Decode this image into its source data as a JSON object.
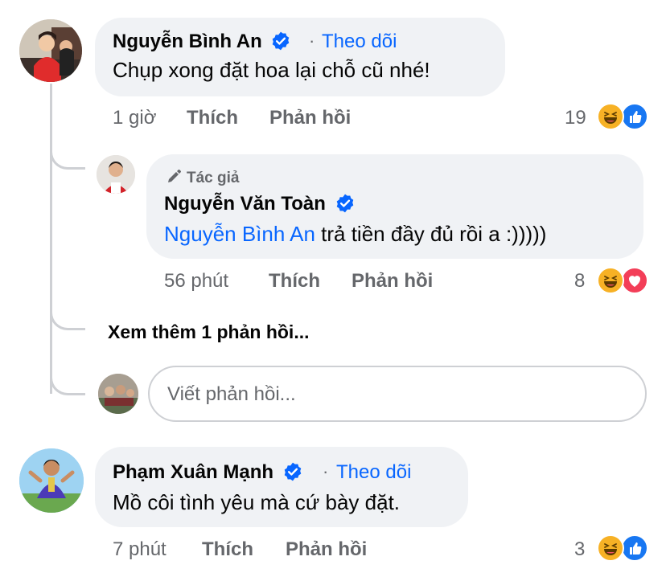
{
  "comment1": {
    "author": "Nguyễn Bình An",
    "follow_label": "Theo dõi",
    "text": "Chụp xong đặt hoa lại chỗ cũ nhé!",
    "time": "1 giờ",
    "like_label": "Thích",
    "reply_label": "Phản hồi",
    "reaction_count": "19",
    "reactions": [
      "haha-icon",
      "like-icon"
    ]
  },
  "reply1": {
    "author_badge": "Tác giả",
    "author": "Nguyễn Văn Toàn",
    "mention": "Nguyễn Bình An",
    "text": " trả tiền đầy đủ rồi a  :)))))",
    "time": "56 phút",
    "like_label": "Thích",
    "reply_label": "Phản hồi",
    "reaction_count": "8",
    "reactions": [
      "haha-icon",
      "love-icon"
    ]
  },
  "more_replies_label": "Xem thêm 1 phản hồi...",
  "reply_input": {
    "placeholder": "Viết phản hồi..."
  },
  "comment2": {
    "author": "Phạm Xuân Mạnh",
    "follow_label": "Theo dõi",
    "text": "Mồ côi tình yêu mà cứ bày đặt.",
    "time": "7 phút",
    "like_label": "Thích",
    "reply_label": "Phản hồi",
    "reaction_count": "3",
    "reactions": [
      "haha-icon",
      "like-icon"
    ]
  },
  "colors": {
    "link": "#0866ff",
    "bubble": "#f0f2f5",
    "meta": "#65676b",
    "love": "#f33e58",
    "haha": "#f7b125"
  }
}
